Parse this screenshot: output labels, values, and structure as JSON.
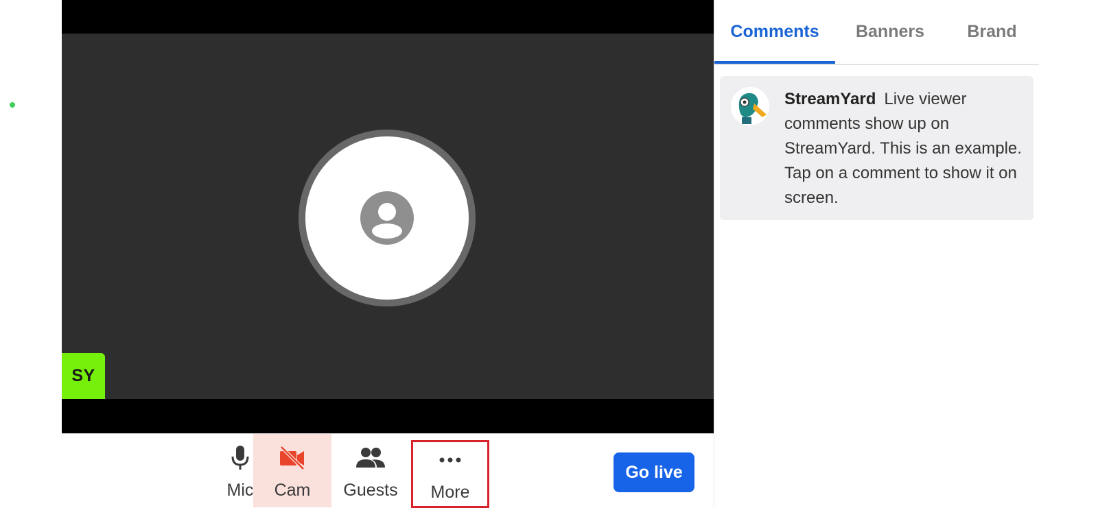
{
  "stage": {
    "name_tag": "SY"
  },
  "controls": {
    "mic_label": "Mic",
    "cam_label": "Cam",
    "guests_label": "Guests",
    "more_label": "More",
    "go_live_label": "Go live"
  },
  "tabs": [
    {
      "label": "Comments",
      "active": true
    },
    {
      "label": "Banners",
      "active": false
    },
    {
      "label": "Brand",
      "active": false
    }
  ],
  "comments": [
    {
      "author": "StreamYard",
      "text": "Live viewer comments show up on StreamYard. This is an example. Tap on a comment to show it on screen."
    }
  ],
  "colors": {
    "accent": "#1764e8",
    "name_tag": "#75f00a",
    "cam_off": "#e8452c",
    "cam_bg": "#fbe1dc",
    "highlight": "#d8232a",
    "status": "#3fcf5a"
  },
  "icons": {
    "mic": "microphone-icon",
    "cam": "camera-off-icon",
    "guests": "people-icon",
    "more": "more-dots-icon",
    "avatar": "person-avatar-icon",
    "comment_avatar": "duck-logo-icon"
  }
}
